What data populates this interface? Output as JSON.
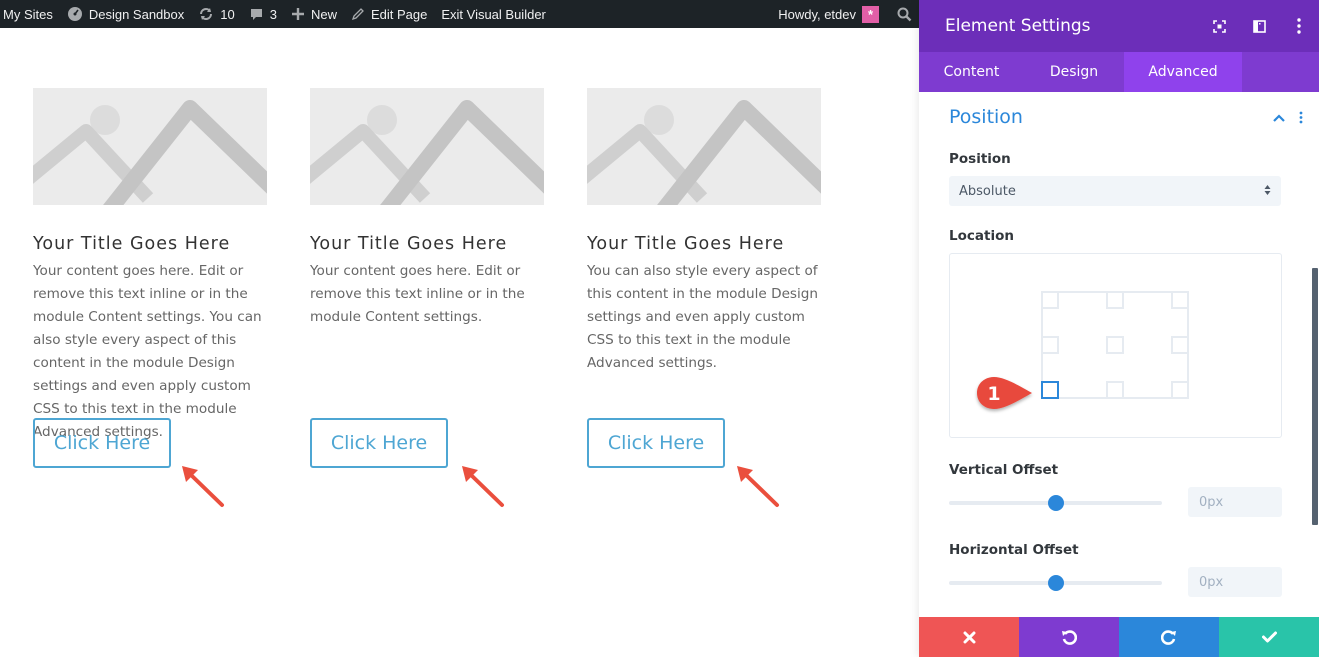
{
  "adminbar": {
    "my_sites": "My Sites",
    "site_name": "Design Sandbox",
    "updates_count": "10",
    "comments_count": "3",
    "new_label": "New",
    "edit_page": "Edit Page",
    "exit_builder": "Exit Visual Builder",
    "howdy": "Howdy, etdev"
  },
  "modules": [
    {
      "title": "Your Title Goes Here",
      "body": "Your content goes here. Edit or remove this text inline or in the module Content settings. You can also style every aspect of this content in the module Design settings and even apply custom CSS to this text in the module Advanced settings.",
      "button": "Click Here"
    },
    {
      "title": "Your Title Goes Here",
      "body": "Your content goes here. Edit or remove this text inline or in the module Content settings.",
      "button": "Click Here"
    },
    {
      "title": "Your Title Goes Here",
      "body": "You can also style every aspect of this content in the module Design settings and even apply custom CSS to this text in the module Advanced settings.",
      "button": "Click Here"
    }
  ],
  "panel": {
    "title": "Element Settings",
    "tabs": [
      {
        "label": "Content",
        "active": false
      },
      {
        "label": "Design",
        "active": false
      },
      {
        "label": "Advanced",
        "active": true
      }
    ],
    "section_title": "Position",
    "position_label": "Position",
    "position_value": "Absolute",
    "location_label": "Location",
    "location_selected": "bottom-left",
    "badge_number": "1",
    "vertical_offset_label": "Vertical Offset",
    "vertical_offset_value": "0px",
    "vertical_offset_slider": 0.5,
    "horizontal_offset_label": "Horizontal Offset",
    "horizontal_offset_value": "0px",
    "horizontal_offset_slider": 0.5
  },
  "colors": {
    "purple_header": "#6c2eb9",
    "purple_tabs": "#7e3bd0",
    "accent_blue": "#2b87da",
    "cancel_red": "#ef5555",
    "undo_purple": "#7e3bd0",
    "redo_blue": "#2b87da",
    "save_green": "#29c4a9"
  }
}
